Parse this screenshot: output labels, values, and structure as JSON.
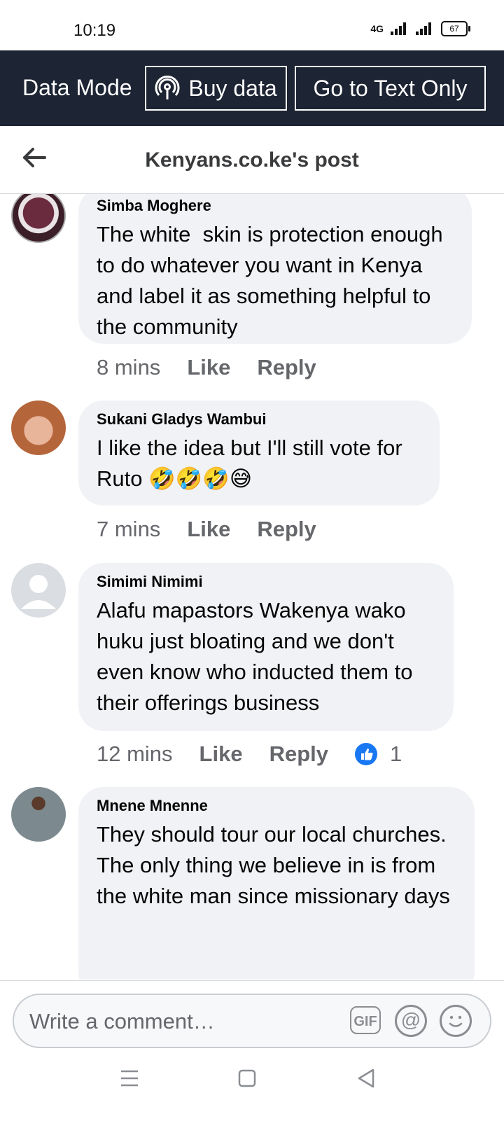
{
  "status": {
    "time": "10:19",
    "network": "4G",
    "battery": "67"
  },
  "data_mode": {
    "label": "Data Mode",
    "buy_data": "Buy data",
    "text_only": "Go to Text Only"
  },
  "header": {
    "title": "Kenyans.co.ke's post"
  },
  "comments": [
    {
      "author": "Simba Moghere",
      "text": "The white  skin is protection enough to do whatever you want in Kenya and label it as something helpful to the community",
      "time": "8 mins",
      "like": "Like",
      "reply": "Reply"
    },
    {
      "author": "Sukani Gladys Wambui",
      "text": "I like the idea but I'll still vote for Ruto 🤣🤣🤣😅",
      "time": "7 mins",
      "like": "Like",
      "reply": "Reply"
    },
    {
      "author": "Simimi Nimimi",
      "text": "Alafu mapastors Wakenya wako huku just bloating and we don't even know who inducted them to their offerings business",
      "time": "12 mins",
      "like": "Like",
      "reply": "Reply",
      "reactions": "1"
    },
    {
      "author": "Mnene Mnenne",
      "text": "They should tour our local churches.\nThe only thing we believe in is from the white man since missionary days"
    }
  ],
  "composer": {
    "placeholder": "Write a comment…",
    "gif": "GIF"
  },
  "colors": {
    "topbar": "#1d2433",
    "bubble": "#f0f2f5",
    "like_blue": "#1877f2"
  },
  "icons": [
    "back-arrow-icon",
    "buy-data-icon",
    "gif-icon",
    "mention-icon",
    "emoji-icon",
    "menu-icon",
    "home-icon",
    "back-icon"
  ]
}
